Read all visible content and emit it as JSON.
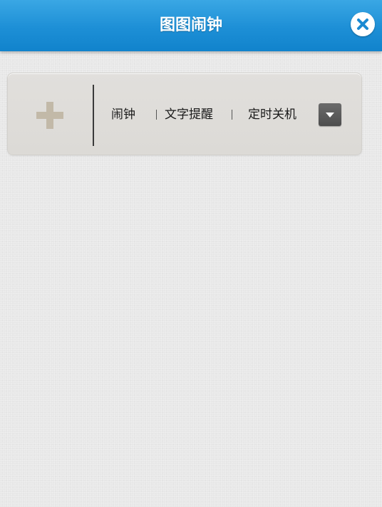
{
  "app": {
    "title": "图图闹钟"
  },
  "header": {
    "close_icon": "close-icon"
  },
  "panel": {
    "add_icon": "plus-icon",
    "options": [
      {
        "label": "闹钟"
      },
      {
        "label": "文字提醒"
      },
      {
        "label": "定时关机"
      }
    ],
    "dropdown_icon": "chevron-down-icon"
  },
  "colors": {
    "titlebar": "#1d8fd6",
    "background": "#e7e7e7",
    "panel": "#dedcd8",
    "plus": "#c2b9a8",
    "dropdown": "#5c5c5c"
  }
}
